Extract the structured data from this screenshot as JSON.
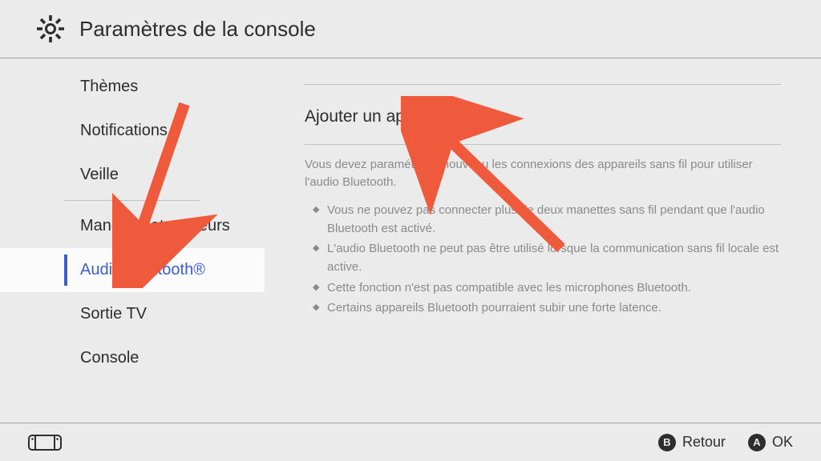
{
  "header": {
    "title": "Paramètres de la console"
  },
  "sidebar": {
    "items": [
      {
        "label": "Thèmes",
        "selected": false
      },
      {
        "label": "Notifications",
        "selected": false
      },
      {
        "label": "Veille",
        "selected": false
      }
    ],
    "items2": [
      {
        "label": "Manettes et capteurs",
        "selected": false
      },
      {
        "label": "Audio Bluetooth®",
        "selected": true
      },
      {
        "label": "Sortie TV",
        "selected": false
      },
      {
        "label": "Console",
        "selected": false
      }
    ]
  },
  "main": {
    "section_title": "Ajouter un appareil",
    "info_text": "Vous devez paramétrer à nouveau les connexions des appareils sans fil pour utiliser l'audio Bluetooth.",
    "bullets": [
      "Vous ne pouvez pas connecter plus de deux manettes sans fil pendant que l'audio Bluetooth est activé.",
      "L'audio Bluetooth ne peut pas être utilisé lorsque la communication sans fil locale est active.",
      "Cette fonction n'est pas compatible avec les microphones Bluetooth.",
      "Certains appareils Bluetooth pourraient subir une forte latence."
    ]
  },
  "footer": {
    "b_label": "Retour",
    "a_label": "OK"
  }
}
